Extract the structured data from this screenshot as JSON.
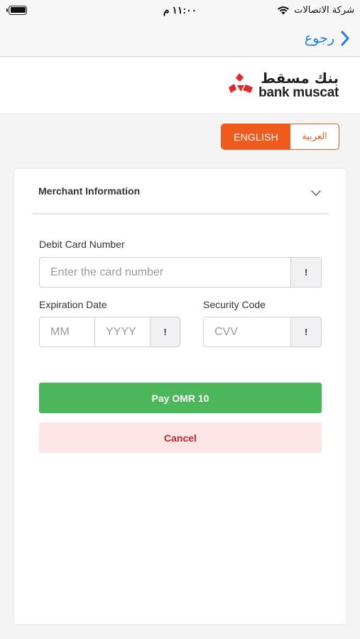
{
  "status_bar": {
    "time": "١١:٠٠ م",
    "carrier": "شركة الاتصالات",
    "icons": [
      "battery-icon",
      "wifi-icon"
    ]
  },
  "nav": {
    "back_label": "رجوع",
    "back_icon": "chevron-right-icon",
    "accent_color": "#1a7ef0"
  },
  "logo": {
    "arabic": "بنك مسقط",
    "english": "bank muscat",
    "brand_color": "#e5262d"
  },
  "language": {
    "english_label": "ENGLISH",
    "arabic_label": "العربية",
    "selected": "ENGLISH",
    "accent_color": "#f15a1d"
  },
  "form": {
    "merchant_info_label": "Merchant Information",
    "card_number_label": "Debit Card Number",
    "card_number_placeholder": "Enter the card number",
    "expiration_label": "Expiration Date",
    "month_placeholder": "MM",
    "year_placeholder": "YYYY",
    "security_label": "Security Code",
    "cvv_placeholder": "CVV",
    "info_symbol": "!"
  },
  "actions": {
    "pay_label": "Pay OMR 10",
    "pay_color": "#4cb65a",
    "cancel_label": "Cancel",
    "cancel_color": "#c0272d"
  }
}
